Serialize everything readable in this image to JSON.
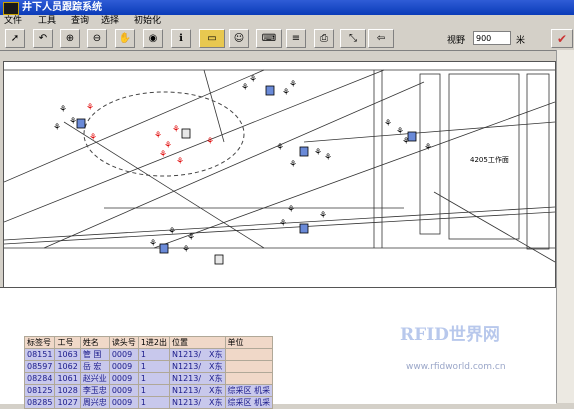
{
  "window": {
    "title": "井下人员跟踪系统"
  },
  "menu": [
    "文件",
    "工具",
    "查询",
    "选择",
    "初始化"
  ],
  "toolbar": {
    "buttons": [
      "pointer-icon",
      "undo-icon",
      "zoom-in-icon",
      "zoom-out-icon",
      "pan-hand-icon",
      "target-icon",
      "info-icon",
      "ruler-icon",
      "person-icon",
      "keyboard-icon",
      "layers-icon",
      "printer-icon",
      "arrows-icon",
      "exit-icon"
    ],
    "zoom_label": "视野",
    "zoom_value": "900",
    "zoom_unit": "米",
    "ok_icon": "check-icon"
  },
  "map": {
    "labels": {
      "storage": "4205工作面"
    },
    "reader_positions": [
      "reader-1",
      "reader-2",
      "reader-3",
      "reader-4",
      "reader-5",
      "reader-6",
      "reader-7",
      "reader-8"
    ]
  },
  "table": {
    "headers": [
      "标签号",
      "工号",
      "姓名",
      "读头号",
      "1进2出",
      "位置",
      "单位"
    ],
    "rows": [
      [
        "08151",
        "1063",
        "管 国",
        "0009",
        "1",
        "N1213/　X东",
        ""
      ],
      [
        "08597",
        "1062",
        "岳 宏",
        "0009",
        "1",
        "N1213/　X东",
        ""
      ],
      [
        "08284",
        "1061",
        "赵兴业",
        "0009",
        "1",
        "N1213/　X东",
        ""
      ],
      [
        "08125",
        "1028",
        "李玉忠",
        "0009",
        "1",
        "N1213/　X东",
        "综采区 机采"
      ],
      [
        "08285",
        "1027",
        "周兴忠",
        "0009",
        "1",
        "N1213/　X东",
        "综采区 机采"
      ]
    ]
  },
  "watermark": {
    "logo": "RFID世界网",
    "url": "www.rfidworld.com.cn"
  },
  "colors": {
    "title_bg": "#0a3bb8",
    "row_bg": "#c8c8ec",
    "header_bg": "#f0d8c8",
    "alert": "#e00000"
  }
}
